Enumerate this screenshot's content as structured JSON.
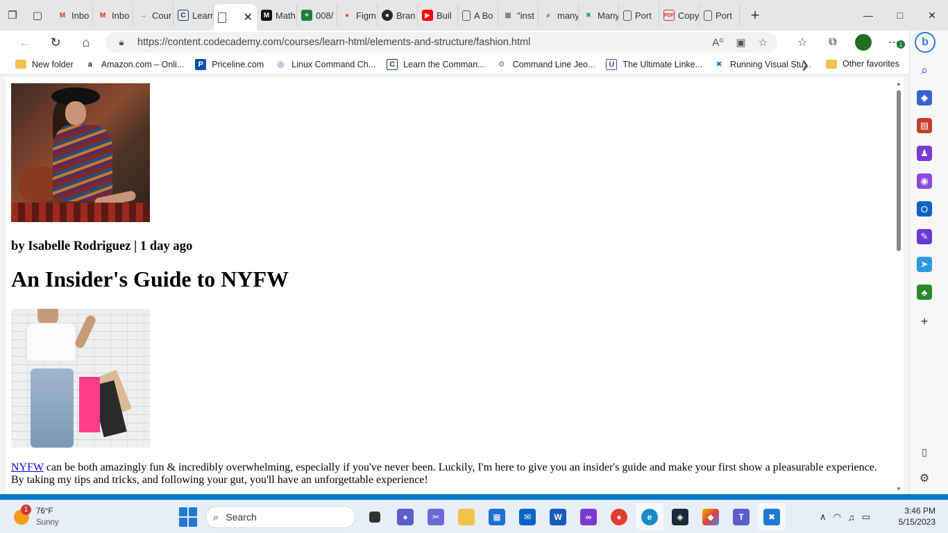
{
  "browser": {
    "tabs": [
      {
        "label": "",
        "icon": "workspaces-icon"
      },
      {
        "label": "",
        "icon": "tab-actions-icon"
      },
      {
        "label": "Inbo",
        "icon": "gmail-icon",
        "color": "#d93025"
      },
      {
        "label": "Inbo",
        "icon": "gmail-icon",
        "color": "#d93025"
      },
      {
        "label": "Cour",
        "icon": "arrow-icon",
        "color": "#555555"
      },
      {
        "label": "Learn",
        "icon": "codecademy-icon",
        "color": "#1b3a5c"
      },
      {
        "label": "",
        "icon": "page-icon",
        "color": "#555555",
        "active": true
      },
      {
        "label": "Math",
        "icon": "m-icon",
        "color": "#111111"
      },
      {
        "label": "008/",
        "icon": "sheets-icon",
        "color": "#188038"
      },
      {
        "label": "Figm",
        "icon": "figma-icon",
        "color": "#f24e1e"
      },
      {
        "label": "Bran",
        "icon": "github-icon",
        "color": "#24292e"
      },
      {
        "label": "Buil",
        "icon": "youtube-icon",
        "color": "#ff0000"
      },
      {
        "label": "A Bo",
        "icon": "page-icon",
        "color": "#555555"
      },
      {
        "label": "\"inst",
        "icon": "image-icon",
        "color": "#555555"
      },
      {
        "label": "many",
        "icon": "search-icon",
        "color": "#555555"
      },
      {
        "label": "Many",
        "icon": "x-icon",
        "color": "#2e9e6b"
      },
      {
        "label": "Port",
        "icon": "page-icon",
        "color": "#555555"
      },
      {
        "label": "Copy",
        "icon": "pdf-icon",
        "color": "#d13438"
      },
      {
        "label": "Port",
        "icon": "page-icon",
        "color": "#555555"
      }
    ],
    "url": "https://content.codecademy.com/courses/learn-html/elements-and-structure/fashion.html",
    "bookmarks": [
      {
        "label": "New folder",
        "icon": "folder-icon"
      },
      {
        "label": "Amazon.com – Onli...",
        "icon": "amazon-icon"
      },
      {
        "label": "Priceline.com",
        "icon": "priceline-icon"
      },
      {
        "label": "Linux Command Ch...",
        "icon": "globe-icon"
      },
      {
        "label": "Learn the Comman...",
        "icon": "codecademy-icon"
      },
      {
        "label": "Command Line Jeo...",
        "icon": "gear-icon"
      },
      {
        "label": "The Ultimate Linke...",
        "icon": "linkedin-icon"
      },
      {
        "label": "Running Visual Stu...",
        "icon": "vscode-icon"
      }
    ],
    "other_favorites": "Other favorites",
    "extension_badge": "1"
  },
  "page": {
    "byline": "by Isabelle Rodriguez | 1 day ago",
    "headline": "An Insider's Guide to NYFW",
    "link_text": "NYFW",
    "paragraph_rest": " can be both amazingly fun & incredibly overwhelming, especially if you've never been. Luckily, I'm here to give you an insider's guide and make your first show a pleasurable experience. By taking my tips and tricks, and following your gut, you'll have an unforgettable experience!"
  },
  "taskbar": {
    "weather_temp": "76°F",
    "weather_cond": "Sunny",
    "weather_badge": "1",
    "search_placeholder": "Search",
    "time": "3:46 PM",
    "date": "5/15/2023"
  }
}
